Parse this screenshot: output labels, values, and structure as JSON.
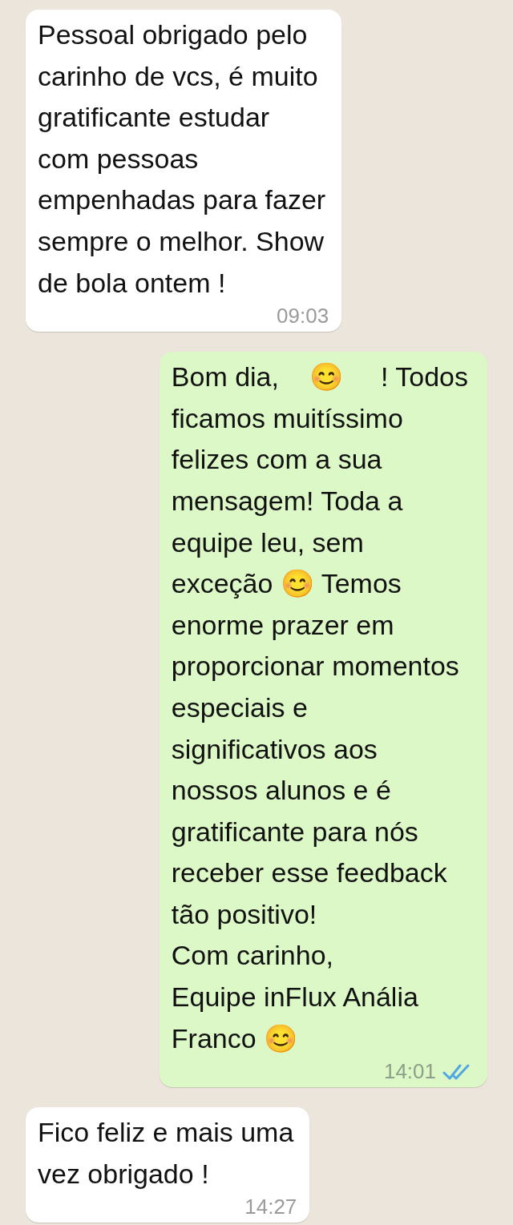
{
  "messages": [
    {
      "kind": "incoming",
      "text": "Pessoal obrigado pelo\ncarinho de vcs, é muito\ngratificante estudar\ncom pessoas\nempenhadas para fazer\nsempre o melhor. Show\nde bola ontem !",
      "time": "09:03"
    },
    {
      "kind": "outgoing",
      "text": "Bom dia,    😊     ! Todos\nficamos muitíssimo\nfelizes com a sua\nmensagem! Toda a\nequipe leu, sem\nexceção 😊 Temos\nenorme prazer em\nproporcionar momentos\nespeciais e\nsignificativos aos\nnossos alunos e é\ngratificante para nós\nreceber esse feedback\ntão positivo!\nCom carinho,\nEquipe inFlux Anália\nFranco 😊",
      "time": "14:01",
      "read": true
    },
    {
      "kind": "incoming",
      "text": "Fico feliz e mais uma\nvez obrigado !",
      "time": "14:27"
    }
  ]
}
